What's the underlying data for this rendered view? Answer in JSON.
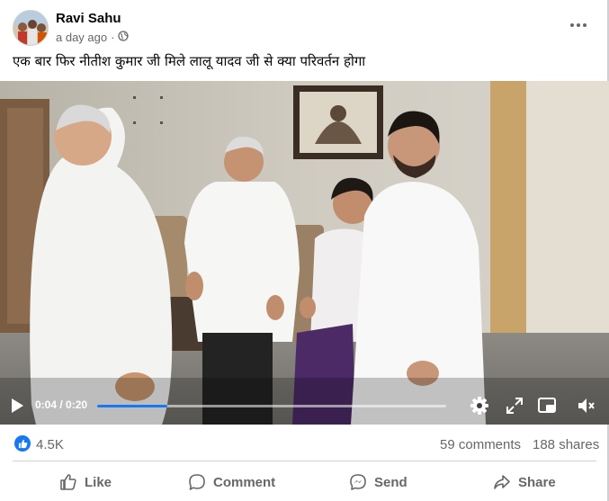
{
  "post": {
    "author": "Ravi Sahu",
    "timestamp": "a day ago",
    "meta_separator": "·",
    "audience_icon": "globe-icon",
    "caption": "एक बार फिर नीतीश कुमार जी मिले लालू यादव जी से क्या परिवर्तन होगा"
  },
  "video": {
    "current_time": "0:04",
    "duration": "0:20",
    "time_label": "0:04 / 0:20",
    "progress_fraction": 0.2,
    "icons": [
      "play-icon",
      "settings-gear-icon",
      "fullscreen-expand-icon",
      "picture-in-picture-icon",
      "volume-muted-icon"
    ]
  },
  "stats": {
    "reaction_count": "4.5K",
    "comments": "59 comments",
    "shares": "188 shares"
  },
  "actions": {
    "like": "Like",
    "comment": "Comment",
    "send": "Send",
    "share": "Share"
  },
  "colors": {
    "accent": "#1877f2",
    "secondary_text": "#65676b",
    "divider": "#ced0d4"
  }
}
